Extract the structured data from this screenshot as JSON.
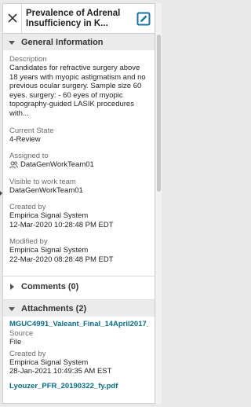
{
  "header": {
    "title_line1": "Prevalence of Adrenal",
    "title_line2": "Insufficiency in K..."
  },
  "general": {
    "section_label": "General Information",
    "description_label": "Description",
    "description_lines": [
      "Candidates for refractive surgery above",
      "18 years with myopic astigmatism and no",
      "previous ocular surgery. Sample size 60",
      "eyes. surgery: - 60 eyes of myopic",
      "topography-guided LASIK procedures",
      "with..."
    ],
    "current_state_label": "Current State",
    "current_state_value": "4-Review",
    "assigned_to_label": "Assigned to",
    "assigned_to_value": "DataGenWorkTeam01",
    "visible_label": "Visible to work team",
    "visible_value": "DataGenWorkTeam01",
    "created_by_label": "Created by",
    "created_by_value": "Empirica Signal System",
    "created_date": "12-Mar-2020 10:28:48 PM EDT",
    "modified_by_label": "Modified by",
    "modified_by_value": "Empirica Signal System",
    "modified_date": "22-Mar-2020 08:28:48 PM EDT"
  },
  "comments": {
    "section_label": "Comments (0)"
  },
  "attachments": {
    "section_label": "Attachments (2)",
    "items": [
      {
        "name": "MGUC4991_Valeant_Final_14April2017_",
        "source_label": "Source",
        "source_value": "File",
        "created_by_label": "Created by",
        "created_by_value": "Empirica Signal System",
        "created_date": "28-Jan-2021 10:49:35 AM EST"
      },
      {
        "name": "Lyouzer_PFR_20190322_fy.pdf"
      }
    ]
  },
  "icons": {
    "close": "close-icon",
    "edit": "edit-icon",
    "caret_down": "caret-down-icon",
    "caret_right": "caret-right-icon",
    "team": "team-icon"
  },
  "colors": {
    "section_bg": "#ebebeb",
    "link": "#0a6b8a",
    "edit_icon": "#1a6fa0"
  }
}
